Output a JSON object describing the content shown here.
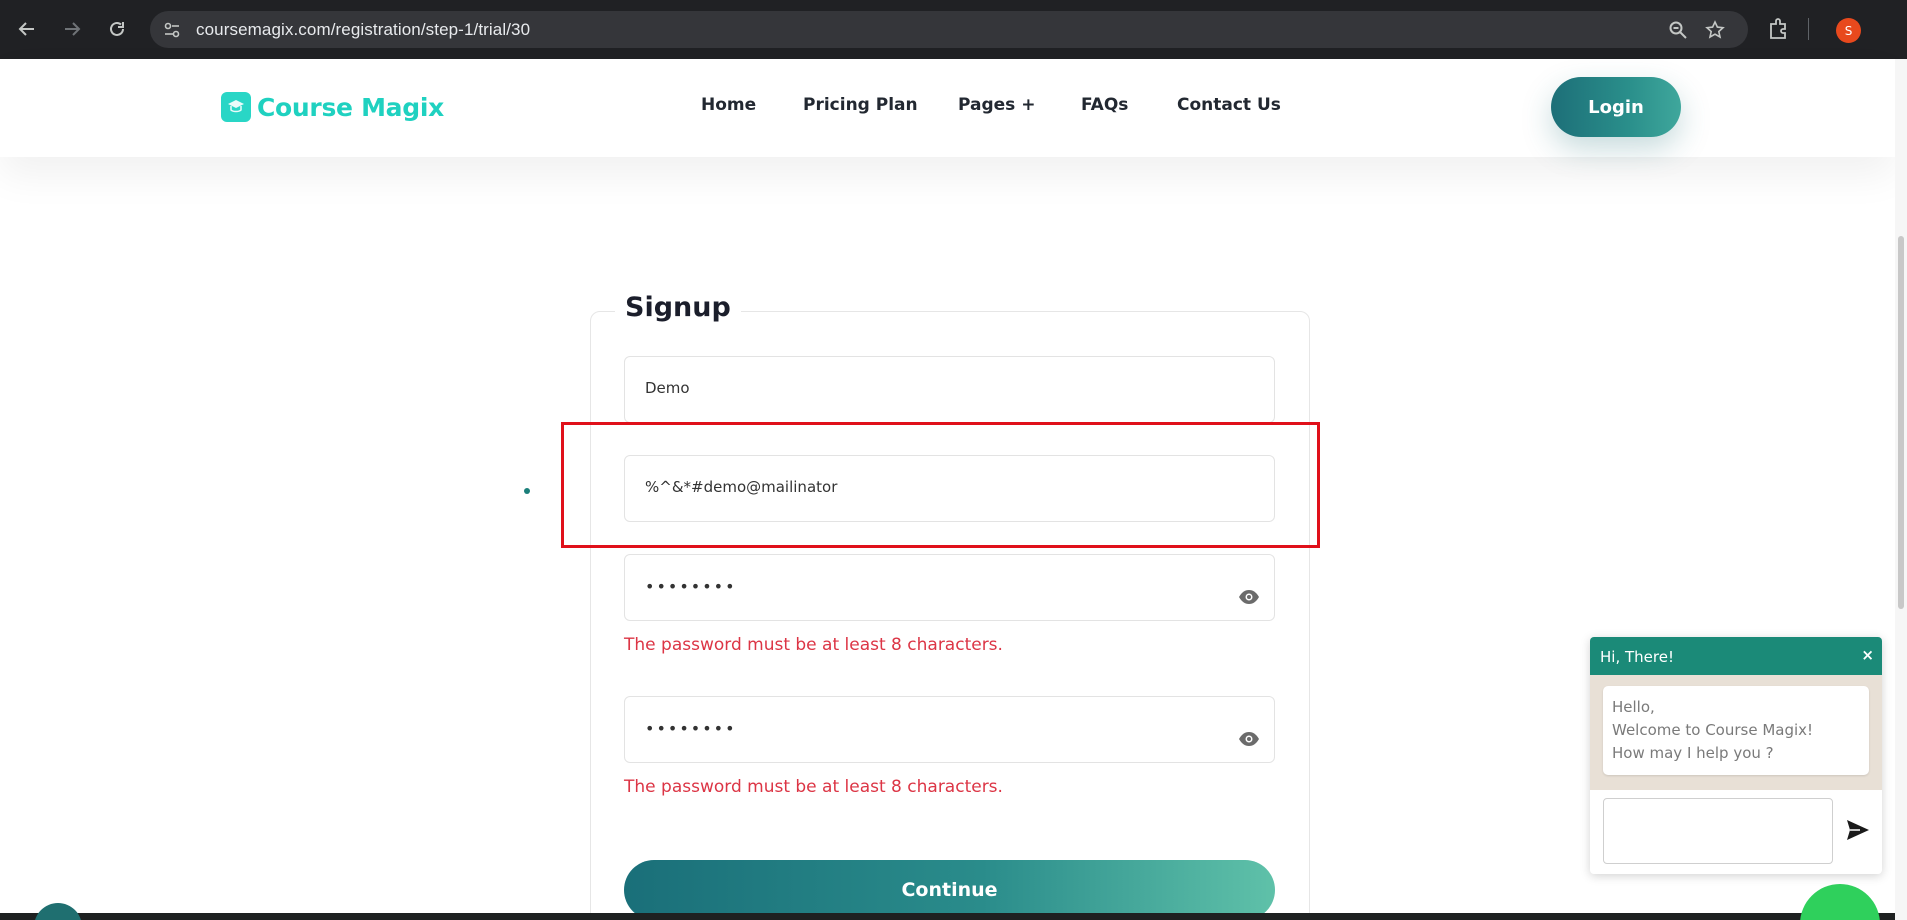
{
  "browser": {
    "url": "coursemagix.com/registration/step-1/trial/30",
    "profile_initial": "S"
  },
  "header": {
    "logo_text": "Course Magix",
    "nav": [
      {
        "label": "Home"
      },
      {
        "label": "Pricing Plan"
      },
      {
        "label": "Pages +"
      },
      {
        "label": "FAQs"
      },
      {
        "label": "Contact Us"
      }
    ],
    "login_label": "Login"
  },
  "form": {
    "title": "Signup",
    "name_value": "Demo",
    "email_value": "%^&*#demo@mailinator",
    "password_value": "••••••••",
    "confirm_password_value": "••••••••",
    "password_error": "The password must be at least 8 characters.",
    "confirm_password_error": "The password must be at least 8 characters.",
    "continue_label": "Continue"
  },
  "chat": {
    "header": "Hi, There!",
    "close": "×",
    "message_lines": [
      "Hello,",
      "Welcome to Course Magix!",
      "How may I help you ?"
    ]
  },
  "colors": {
    "brand_teal": "#1fd1c0",
    "button_teal": "#1d6f78",
    "error_red": "#dc3545",
    "highlight_red": "#e0101a",
    "chat_green": "#1b8a78"
  },
  "icons": [
    "back-arrow-icon",
    "forward-arrow-icon",
    "reload-icon",
    "site-settings-icon",
    "zoom-icon",
    "star-icon",
    "extensions-icon",
    "eye-icon",
    "send-icon",
    "graduation-cap-icon",
    "whatsapp-icon"
  ]
}
